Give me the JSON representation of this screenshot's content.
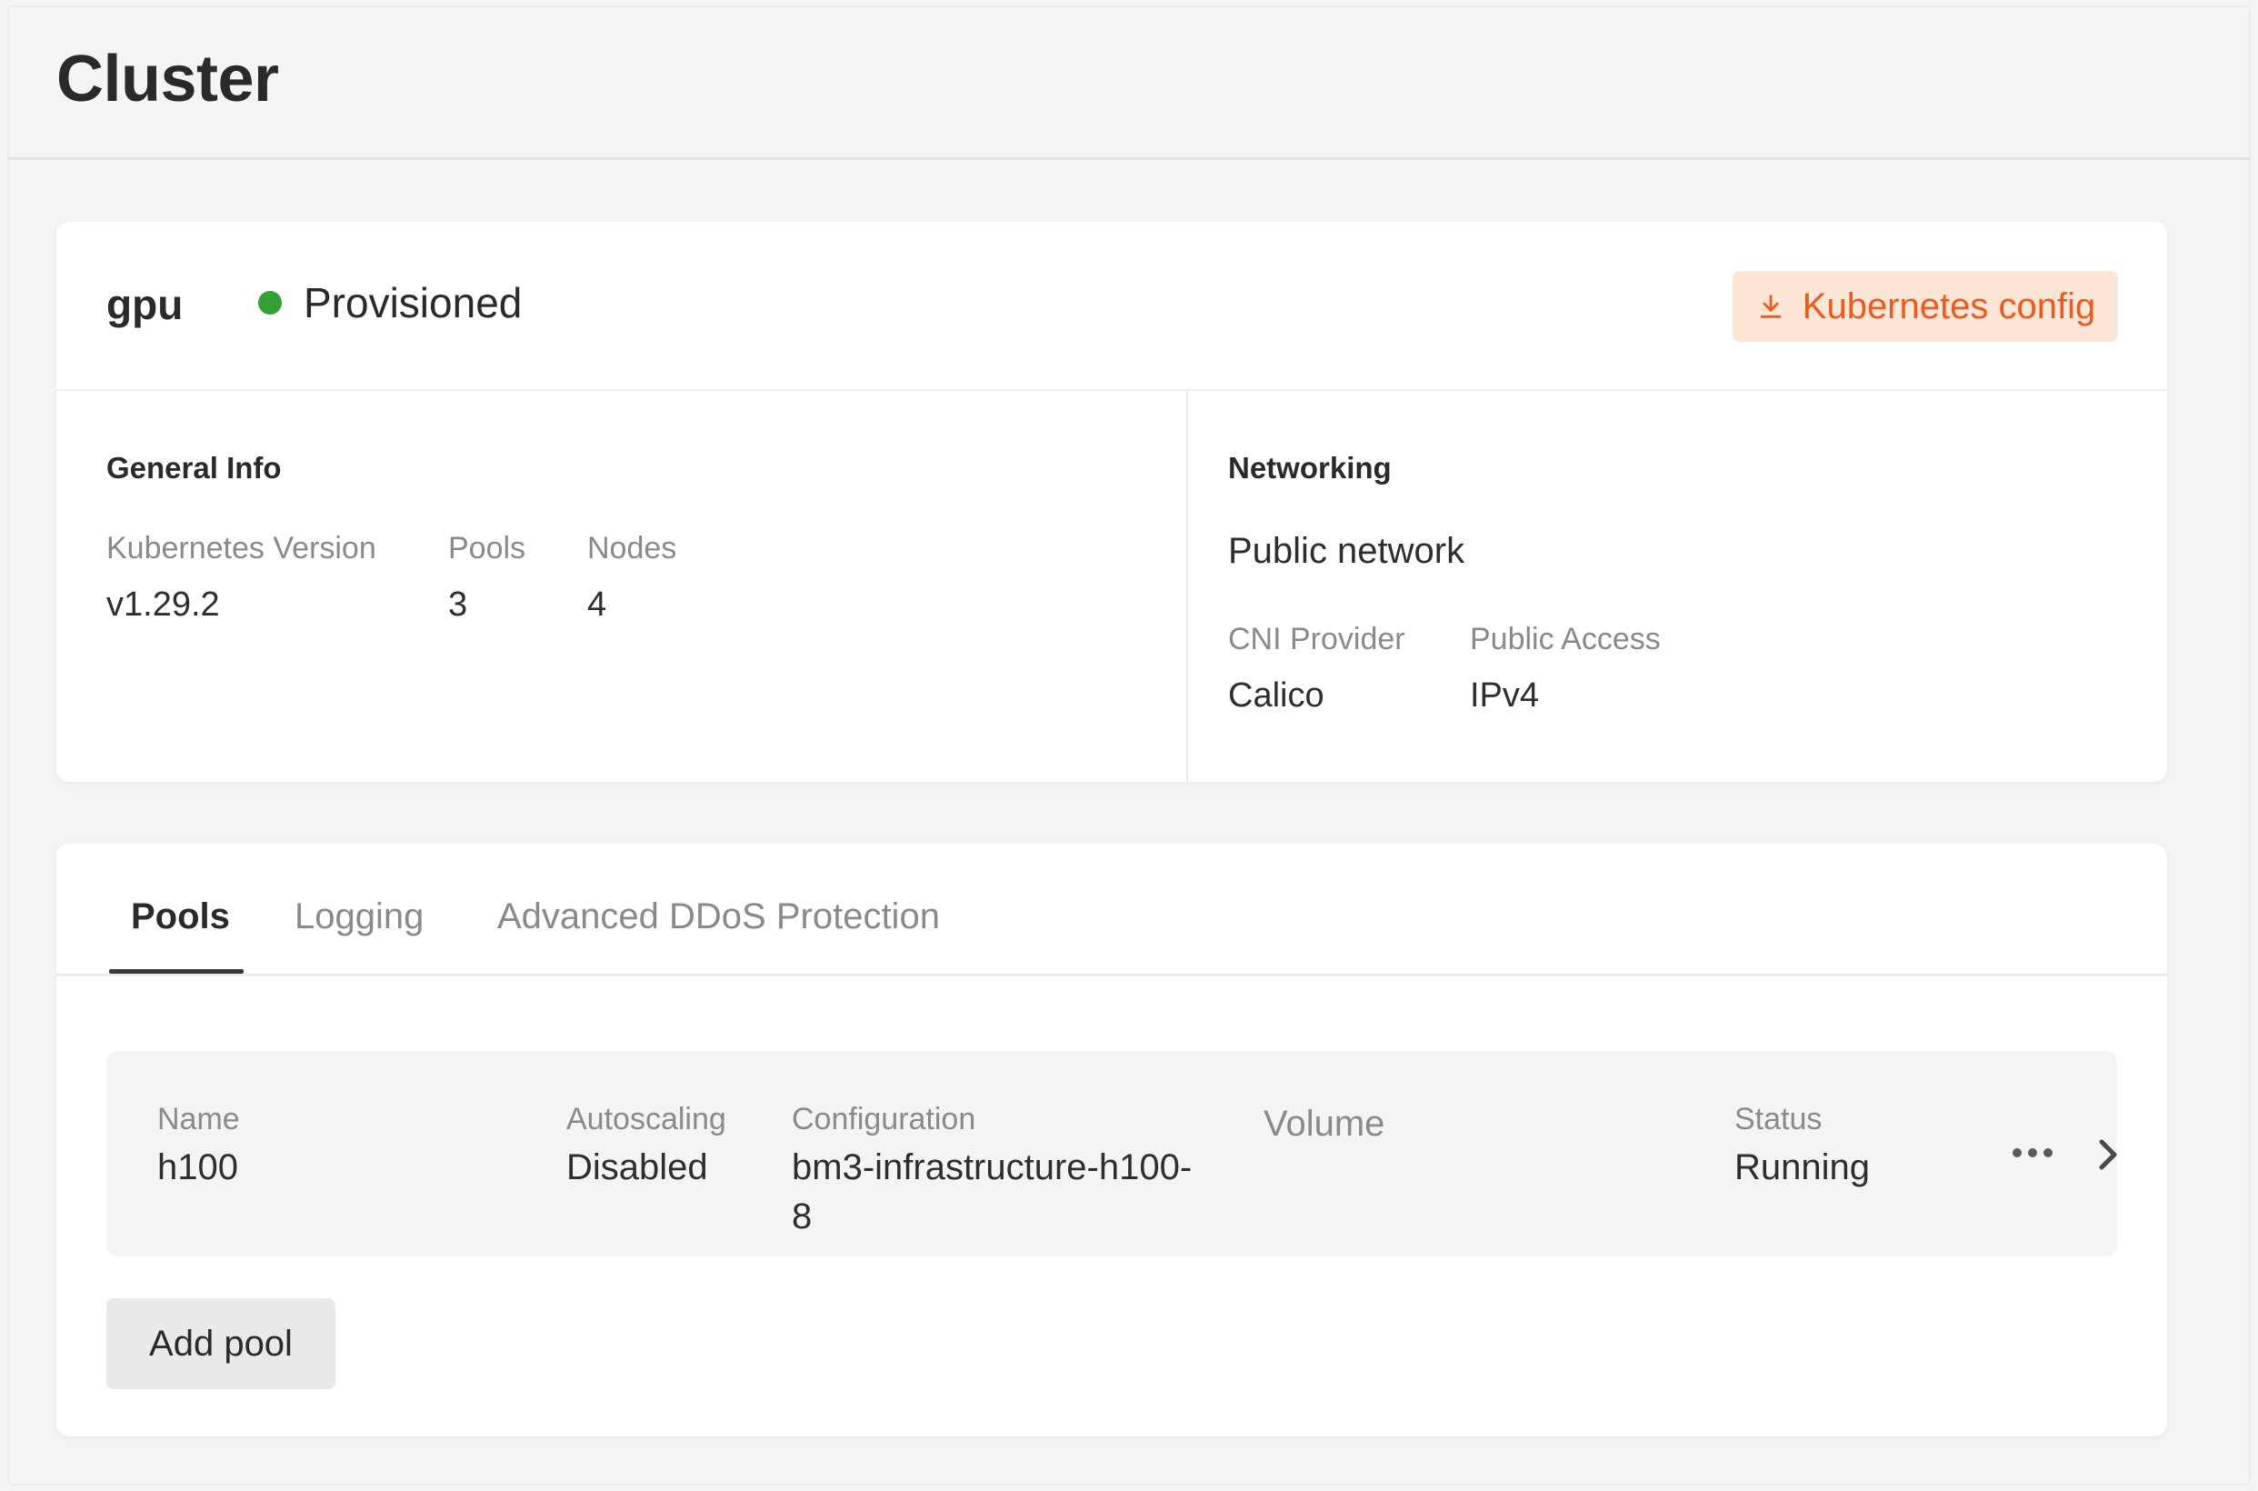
{
  "page": {
    "title": "Cluster"
  },
  "cluster": {
    "name": "gpu",
    "status": "Provisioned",
    "status_color": "#35a035",
    "kube_config_label": "Kubernetes config",
    "accent_color": "#ee5a1e"
  },
  "general_info": {
    "title": "General Info",
    "k8s_version_label": "Kubernetes Version",
    "k8s_version": "v1.29.2",
    "pools_label": "Pools",
    "pools": "3",
    "nodes_label": "Nodes",
    "nodes": "4"
  },
  "networking": {
    "title": "Networking",
    "network_type": "Public network",
    "cni_label": "CNI Provider",
    "cni": "Calico",
    "access_label": "Public Access",
    "access": "IPv4"
  },
  "tabs": [
    {
      "label": "Pools",
      "active": true
    },
    {
      "label": "Logging",
      "active": false
    },
    {
      "label": "Advanced DDoS Protection",
      "active": false
    }
  ],
  "pool_table": {
    "name_label": "Name",
    "autoscaling_label": "Autoscaling",
    "configuration_label": "Configuration",
    "volume_label": "Volume",
    "status_label": "Status",
    "rows": [
      {
        "name": "h100",
        "autoscaling": "Disabled",
        "configuration_line1": "bm3-infrastructure-h100-",
        "configuration_line2": "8",
        "volume": "",
        "status": "Running"
      }
    ]
  },
  "add_pool_label": "Add pool",
  "icons": {
    "download": "download-icon",
    "more": "more-horizontal-icon",
    "chevron": "chevron-right-icon"
  }
}
